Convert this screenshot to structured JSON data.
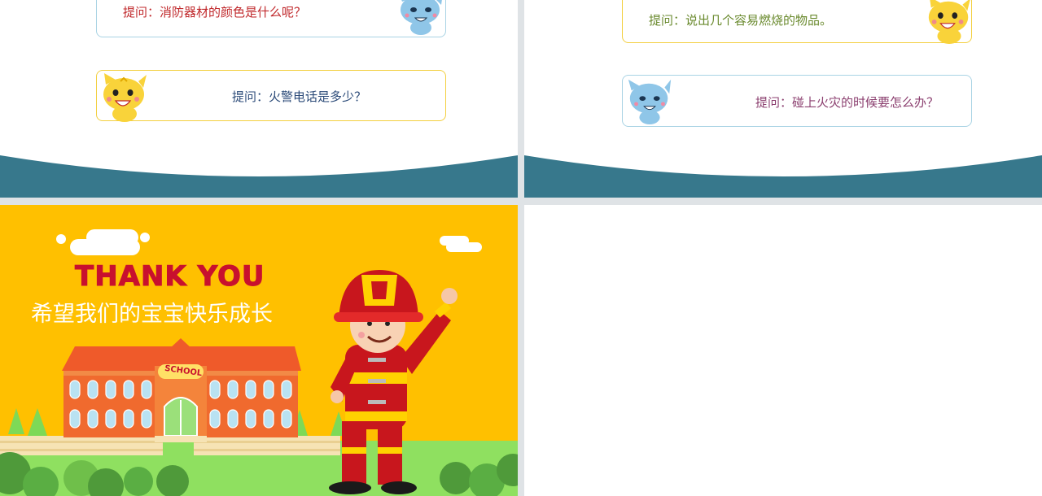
{
  "slides": {
    "top_left": {
      "question_1": "提问：消防器材的颜色是什么呢？",
      "question_2": "提问：火警电话是多少？"
    },
    "top_right": {
      "question_1": "提问：说出几个容易燃烧的物品。",
      "question_2": "提问：碰上火灾的时候要怎么办？"
    },
    "closing": {
      "title": "THANK YOU",
      "subtitle": "希望我们的宝宝快乐成长",
      "school_sign": "SCHOOL"
    }
  },
  "colors": {
    "wave": "#37788c",
    "question_red": "#c0282b",
    "question_navy": "#2b4a78",
    "question_green": "#6a8a2e",
    "question_purple": "#8b3f6f",
    "closing_bg": "#ffc000",
    "title_red": "#c8102e"
  },
  "icons": [
    "blue-cat-mascot-icon",
    "yellow-cat-mascot-icon",
    "firefighter-illustration",
    "school-building-illustration"
  ]
}
